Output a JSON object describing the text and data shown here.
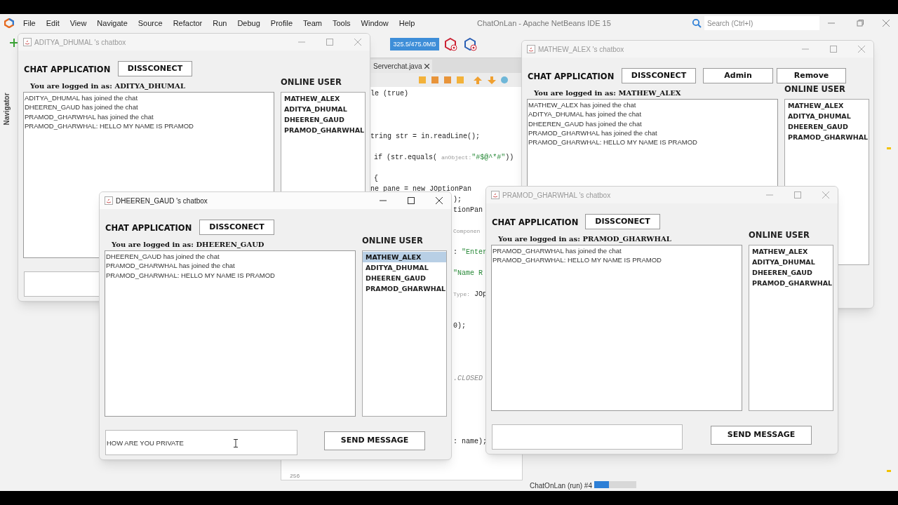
{
  "ide": {
    "title": "ChatOnLan - Apache NetBeans IDE 15",
    "menu": [
      "File",
      "Edit",
      "View",
      "Navigate",
      "Source",
      "Refactor",
      "Run",
      "Debug",
      "Profile",
      "Team",
      "Tools",
      "Window",
      "Help"
    ],
    "search": {
      "placeholder": "Search (Ctrl+I)"
    },
    "memory": "325.5/475.0MB",
    "navigator_label": "Navigator",
    "editor": {
      "tab": "Serverchat.java",
      "line_number": "256",
      "lines": [
        [
          {
            "kind": "code",
            "text": "le (true)"
          }
        ],
        [
          {
            "kind": "code",
            "text": "tring str = in.readLine();"
          }
        ],
        [
          {
            "kind": "code",
            "text": "if (str.equals( "
          },
          {
            "kind": "hint",
            "text": "anObject:"
          },
          {
            "kind": "string",
            "text": "\"#$@^*#\""
          },
          {
            "kind": "code",
            "text": "))"
          }
        ],
        [
          {
            "kind": "code",
            "text": "{"
          }
        ],
        [
          {
            "kind": "code",
            "text": "ne pane = new JOptionPan"
          }
        ],
        [
          {
            "kind": "code",
            "text": ");"
          }
        ],
        [
          {
            "kind": "code",
            "text": "tionPan"
          }
        ],
        [
          {
            "kind": "hint",
            "text": "Componen"
          }
        ],
        [
          {
            "kind": "code",
            "text": ": "
          },
          {
            "kind": "string",
            "text": "\"Enter"
          }
        ],
        [
          {
            "kind": "string",
            "text": "\"Name R"
          }
        ],
        [
          {
            "kind": "hint",
            "text": "Type:"
          },
          {
            "kind": "code",
            "text": " JOp"
          }
        ],
        [
          {
            "kind": "code",
            "text": "0);"
          }
        ],
        [
          {
            "kind": "field",
            "text": ".CLOSED"
          }
        ],
        [
          {
            "kind": "code",
            "text": ": name);"
          }
        ]
      ]
    },
    "status": {
      "task": "ChatOnLan (run) #4",
      "level": 0.35
    }
  },
  "windows": [
    {
      "title": "ADITYA_DHUMAL 's chatbox",
      "active": false,
      "heading": "CHAT APPLICATION",
      "buttons": [
        "DISSCONECT"
      ],
      "logged_in": "You are logged in as: ADITYA_DHUMAL",
      "messages": [
        "ADITYA_DHUMAL has joined the chat",
        "DHEEREN_GAUD has joined the chat",
        "PRAMOD_GHARWHAL has joined the chat",
        "PRAMOD_GHARWHAL: HELLO MY NAME IS PRAMOD"
      ],
      "online_label": "ONLINE USER",
      "online_users": [
        {
          "name": "MATHEW_ALEX",
          "selected": false
        },
        {
          "name": "ADITYA_DHUMAL",
          "selected": false
        },
        {
          "name": "DHEEREN_GAUD",
          "selected": false
        },
        {
          "name": "PRAMOD_GHARWHAL",
          "selected": false
        }
      ]
    },
    {
      "title": "MATHEW_ALEX 's chatbox",
      "active": false,
      "heading": "CHAT APPLICATION",
      "buttons": [
        "DISSCONECT",
        "Admin",
        "Remove"
      ],
      "logged_in": "You are logged in as: MATHEW_ALEX",
      "messages": [
        "MATHEW_ALEX has joined the chat",
        "ADITYA_DHUMAL has joined the chat",
        "DHEEREN_GAUD has joined the chat",
        "PRAMOD_GHARWHAL has joined the chat",
        "PRAMOD_GHARWHAL: HELLO MY NAME IS PRAMOD"
      ],
      "online_label": "ONLINE USER",
      "online_users": [
        {
          "name": "MATHEW_ALEX",
          "selected": false
        },
        {
          "name": "ADITYA_DHUMAL",
          "selected": false
        },
        {
          "name": "DHEEREN_GAUD",
          "selected": false
        },
        {
          "name": "PRAMOD_GHARWHAL",
          "selected": false
        }
      ]
    },
    {
      "title": "DHEEREN_GAUD 's chatbox",
      "active": true,
      "heading": "CHAT APPLICATION",
      "buttons": [
        "DISSCONECT"
      ],
      "logged_in": "You are logged in as: DHEEREN_GAUD",
      "messages": [
        "DHEEREN_GAUD has joined the chat",
        "PRAMOD_GHARWHAL has joined the chat",
        "PRAMOD_GHARWHAL: HELLO MY NAME IS PRAMOD"
      ],
      "online_label": "ONLINE USER",
      "online_users": [
        {
          "name": "MATHEW_ALEX",
          "selected": true
        },
        {
          "name": "ADITYA_DHUMAL",
          "selected": false
        },
        {
          "name": "DHEEREN_GAUD",
          "selected": false
        },
        {
          "name": "PRAMOD_GHARWHAL",
          "selected": false
        }
      ],
      "input": {
        "value": "HOW ARE YOU PRIVATE"
      },
      "send_button": "SEND MESSAGE"
    },
    {
      "title": "PRAMOD_GHARWHAL 's chatbox",
      "active": false,
      "heading": "CHAT APPLICATION",
      "buttons": [
        "DISSCONECT"
      ],
      "logged_in": "You are logged in as: PRAMOD_GHARWHAL",
      "messages": [
        "PRAMOD_GHARWHAL has joined the chat",
        "PRAMOD_GHARWHAL: HELLO MY NAME IS PRAMOD"
      ],
      "online_label": "ONLINE USER",
      "online_users": [
        {
          "name": "MATHEW_ALEX",
          "selected": false
        },
        {
          "name": "ADITYA_DHUMAL",
          "selected": false
        },
        {
          "name": "DHEEREN_GAUD",
          "selected": false
        },
        {
          "name": "PRAMOD_GHARWHAL",
          "selected": false
        }
      ],
      "send_button": "SEND MESSAGE"
    }
  ]
}
